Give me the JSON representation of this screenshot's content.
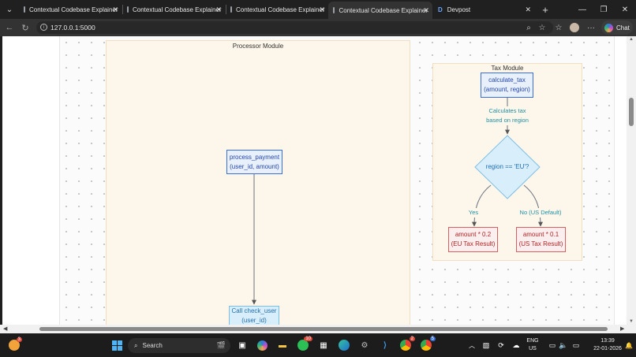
{
  "browser": {
    "tabs": [
      {
        "title": "Contextual Codebase Explainer"
      },
      {
        "title": "Contextual Codebase Explainer"
      },
      {
        "title": "Contextual Codebase Explainer"
      },
      {
        "title": "Contextual Codebase Explainer"
      },
      {
        "title": "Devpost",
        "favicon": "D"
      }
    ],
    "url": "127.0.0.1:5000",
    "chat_label": "Chat"
  },
  "diagram": {
    "processor_module": {
      "title": "Processor Module",
      "nodes": {
        "process_payment": [
          "process_payment",
          "(user_id, amount)"
        ],
        "call_check_user": [
          "Call check_user",
          "(user_id)"
        ]
      }
    },
    "tax_module": {
      "title": "Tax Module",
      "nodes": {
        "calculate_tax": [
          "calculate_tax",
          "(amount, region)"
        ],
        "region_check": "region == 'EU'?",
        "eu_result": [
          "amount * 0.2",
          "(EU Tax Result)"
        ],
        "us_result": [
          "amount * 0.1",
          "(US Tax Result)"
        ]
      },
      "edge_labels": {
        "calc_desc": [
          "Calculates tax",
          "based on region"
        ],
        "yes": "Yes",
        "no": "No (US Default)"
      }
    }
  },
  "taskbar": {
    "search_label": "Search",
    "badges": {
      "widgets": "3",
      "whatsapp": "10",
      "chrome1": "2",
      "chrome2": "5"
    },
    "lang": [
      "ENG",
      "US"
    ],
    "time": "13:39",
    "date": "22-01-2026"
  }
}
